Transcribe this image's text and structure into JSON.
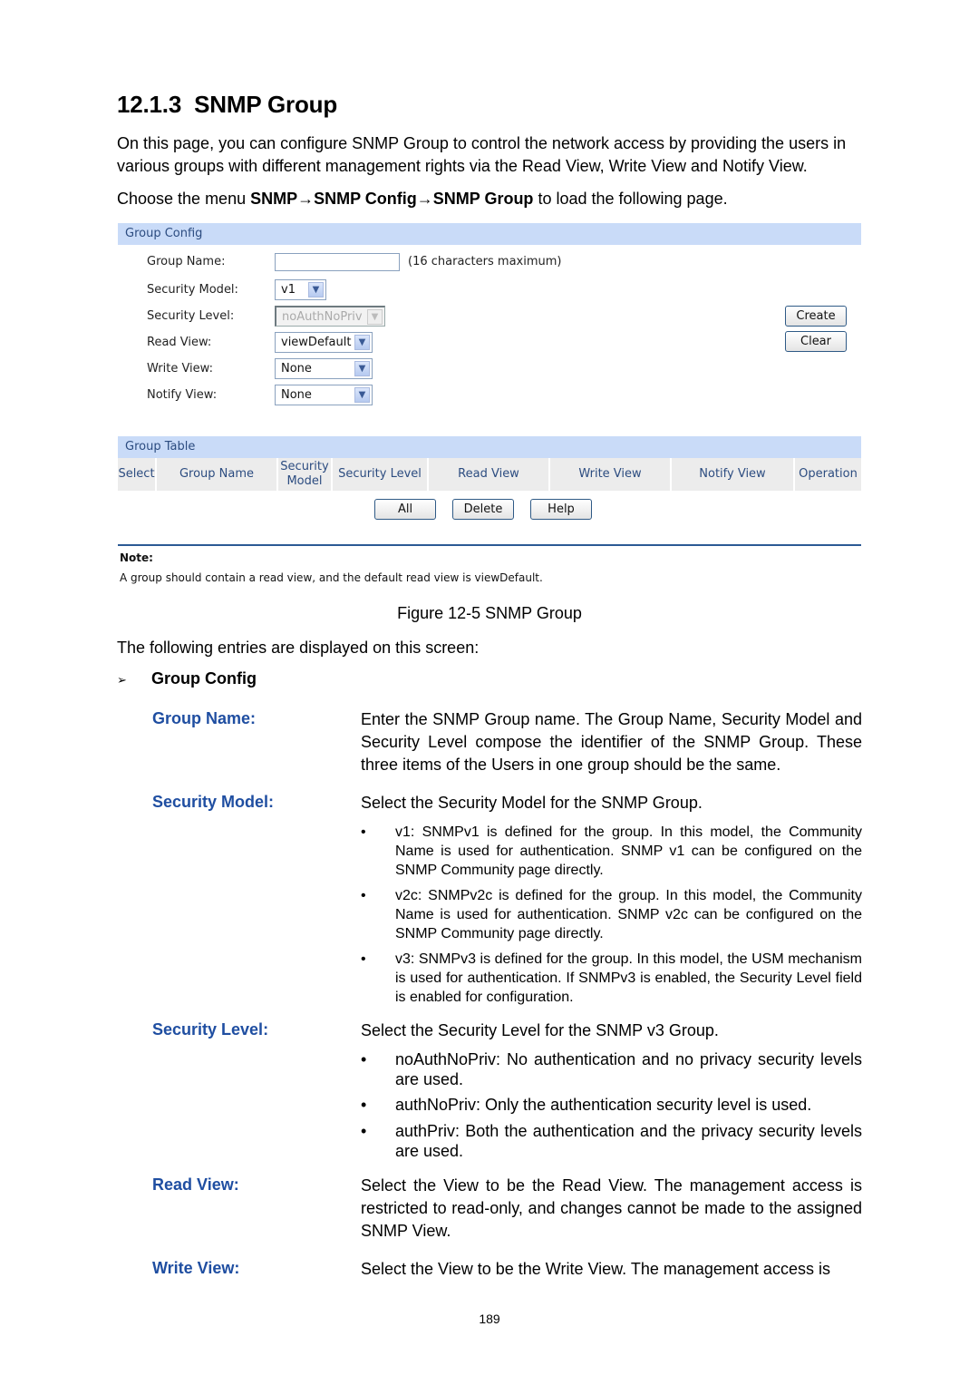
{
  "heading": {
    "number": "12.1.3",
    "title": "SNMP Group"
  },
  "intro": "On this page, you can configure SNMP Group to control the network access by providing the users in various groups with different management rights via the Read View, Write View and Notify View.",
  "menu_path": {
    "prefix": "Choose the menu ",
    "path": "SNMP→SNMP Config→SNMP Group",
    "suffix": " to load the following page."
  },
  "ui": {
    "group_config": {
      "title": "Group Config",
      "fields": [
        {
          "label": "Group Name:",
          "type": "text",
          "value": "",
          "hint": "(16 characters maximum)"
        },
        {
          "label": "Security Model:",
          "type": "select",
          "value": "v1"
        },
        {
          "label": "Security Level:",
          "type": "select",
          "value": "noAuthNoPriv",
          "disabled": true
        },
        {
          "label": "Read View:",
          "type": "select",
          "value": "viewDefault"
        },
        {
          "label": "Write View:",
          "type": "select",
          "value": "None"
        },
        {
          "label": "Notify View:",
          "type": "select",
          "value": "None"
        }
      ],
      "buttons": {
        "create": "Create",
        "clear": "Clear"
      }
    },
    "group_table": {
      "title": "Group Table",
      "columns": [
        "Select",
        "Group Name",
        "Security Model",
        "Security Level",
        "Read View",
        "Write View",
        "Notify View",
        "Operation"
      ],
      "rows": [],
      "buttons": {
        "all": "All",
        "delete": "Delete",
        "help": "Help"
      }
    },
    "note": {
      "title": "Note:",
      "text": "A group should contain a read view, and the default read view is viewDefault."
    },
    "colors": {
      "band": "#c9dbf8",
      "band_text": "#2c4c80",
      "rule": "#2c5a94"
    }
  },
  "figure_caption": "Figure 12-5 SNMP Group",
  "entries_intro": "The following entries are displayed on this screen:",
  "section": {
    "marker": "➢",
    "title": "Group Config"
  },
  "definitions": [
    {
      "term": "Group Name:",
      "desc": "Enter the SNMP Group name. The Group Name, Security Model and Security Level compose the identifier of the SNMP Group. These three items of the Users in one group should be the same."
    },
    {
      "term": "Security Model:",
      "desc": "Select the Security Model for the SNMP Group.",
      "bullets": [
        "v1: SNMPv1 is defined for the group. In this model, the Community Name is used for authentication. SNMP v1 can be configured on the SNMP Community page directly.",
        "v2c: SNMPv2c is defined for the group. In this model, the Community Name is used for authentication. SNMP v2c can be configured on the SNMP Community page directly.",
        "v3: SNMPv3 is defined for the group. In this model, the USM mechanism is used for authentication. If SNMPv3 is enabled, the Security Level field is enabled for configuration."
      ]
    },
    {
      "term": "Security Level:",
      "desc": "Select the Security Level for the SNMP v3 Group.",
      "bullets": [
        "noAuthNoPriv: No authentication and no privacy security levels are used.",
        "authNoPriv: Only the authentication security level is used.",
        "authPriv: Both the authentication and the privacy security levels are used."
      ]
    },
    {
      "term": "Read View:",
      "desc": "Select the View to be the Read View. The management access is restricted to read-only, and changes cannot be made to the assigned SNMP View."
    },
    {
      "term": "Write View:",
      "desc": "Select the View to be the Write View. The management access is"
    }
  ],
  "bullet_glyph": "•",
  "page_number": "189",
  "term_color": "#1f4ea1"
}
